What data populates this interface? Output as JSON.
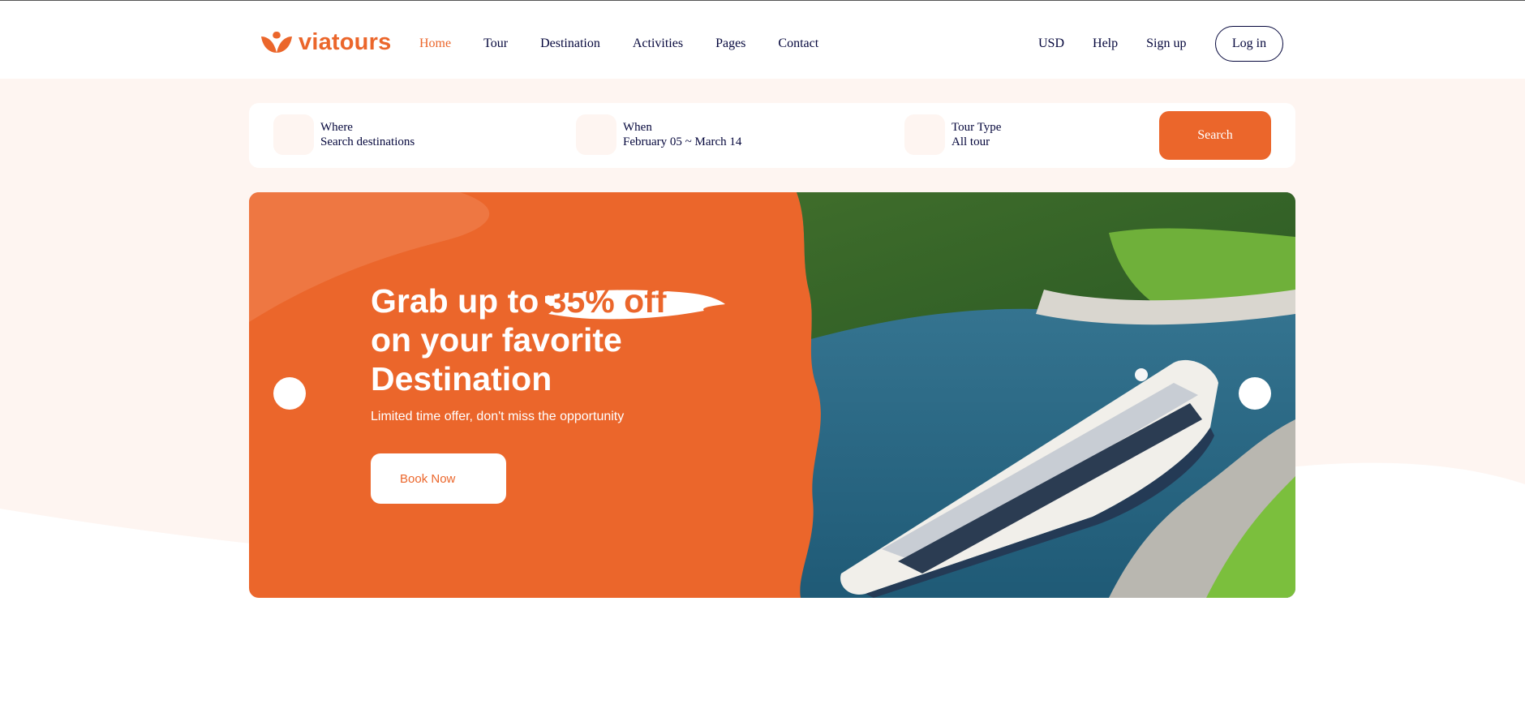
{
  "brand": {
    "name": "viatours",
    "logo_icon": "viatours-flower-icon",
    "accent_color": "#eb662b",
    "dark_color": "#05073c",
    "beige_color": "#fef5f1"
  },
  "nav": {
    "items": [
      {
        "label": "Home",
        "active": true
      },
      {
        "label": "Tour"
      },
      {
        "label": "Destination"
      },
      {
        "label": "Activities"
      },
      {
        "label": "Pages"
      },
      {
        "label": "Contact"
      }
    ]
  },
  "header_right": {
    "currency": "USD",
    "help": "Help",
    "signup": "Sign up",
    "login": "Log in"
  },
  "search": {
    "where": {
      "label": "Where",
      "value": "Search destinations",
      "icon": "location-pin-icon"
    },
    "when": {
      "label": "When",
      "value": "February 05 ~ March 14",
      "icon": "calendar-icon"
    },
    "tour_type": {
      "label": "Tour Type",
      "value": "All tour",
      "icon": "tour-type-icon"
    },
    "button": "Search"
  },
  "hero": {
    "title_pre": "Grab up to",
    "title_highlight": "35% off",
    "title_line2": "on your favorite",
    "title_line3": "Destination",
    "subtitle": "Limited time offer, don't miss the opportunity",
    "cta": "Book Now",
    "image": "cruise-ship-fjord-photo"
  }
}
